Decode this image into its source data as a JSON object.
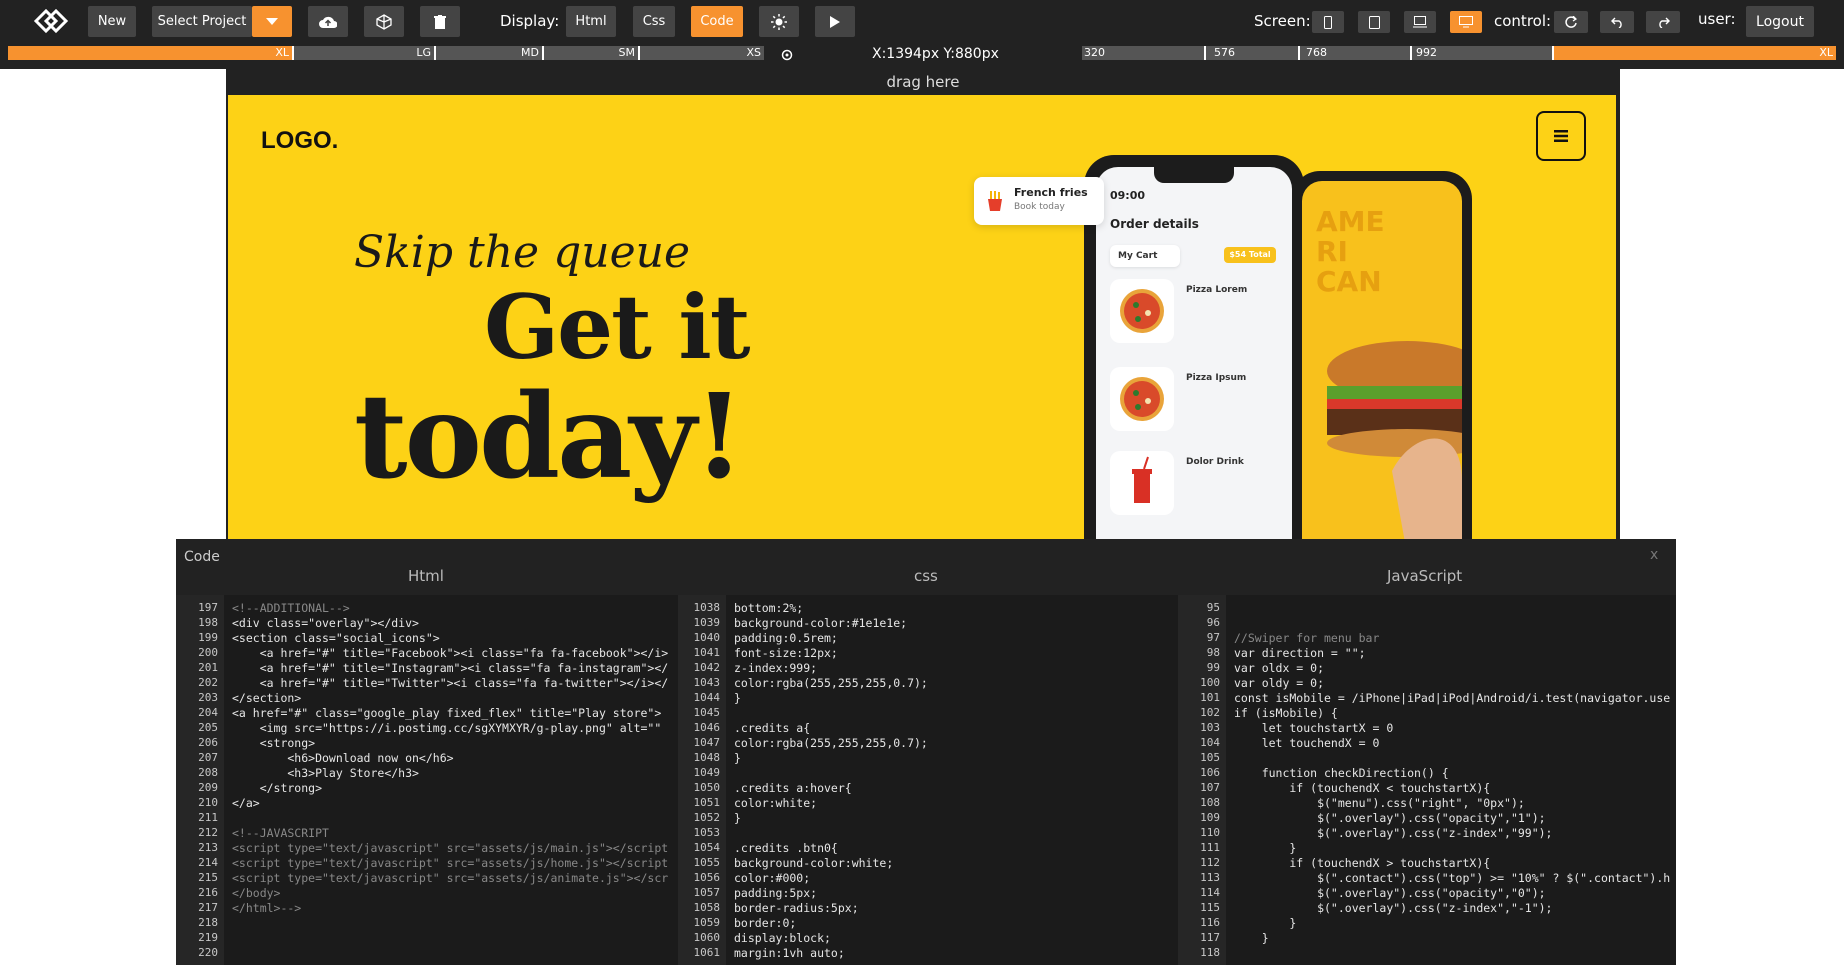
{
  "toolbar": {
    "new_label": "New",
    "project_label": "Select Project",
    "display_label": "Display:",
    "html_label": "Html",
    "css_label": "Css",
    "code_label": "Code",
    "screen_label": "Screen:",
    "control_label": "control:",
    "user_label": "user:",
    "logout_label": "Logout",
    "accent_color": "#f7922f"
  },
  "ruler": {
    "xl_label": "XL",
    "lg_label": "LG",
    "md_label": "MD",
    "sm_label": "SM",
    "xs_label": "XS",
    "coords": "X:1394px Y:880px",
    "bp_320": "320",
    "bp_576": "576",
    "bp_768": "768",
    "bp_992": "992",
    "xl_right": "XL"
  },
  "canvas": {
    "drag_label": "drag here",
    "logo": "LOGO.",
    "tagline": "Skip the queue",
    "headline1": "Get it",
    "headline2": "today!",
    "card_title": "French fries",
    "card_sub": "Book today",
    "phone_time": "09:00",
    "order_title": "Order details",
    "my_cart": "My Cart",
    "total": "$54 Total",
    "item1": "Pizza Lorem",
    "item2": "Pizza Ipsum",
    "item3": "Dolor Drink",
    "brand_color": "#fdd216"
  },
  "code": {
    "title": "Code",
    "close": "x",
    "html_header": "Html",
    "css_header": "css",
    "js_header": "JavaScript",
    "html_lines": [
      {
        "n": "197",
        "t": "<!--ADDITIONAL-->"
      },
      {
        "n": "198",
        "t": "<div class=\"overlay\"></div>"
      },
      {
        "n": "199",
        "t": "<section class=\"social_icons\">"
      },
      {
        "n": "200",
        "t": "    <a href=\"#\" title=\"Facebook\"><i class=\"fa fa-facebook\"></i>"
      },
      {
        "n": "201",
        "t": "    <a href=\"#\" title=\"Instagram\"><i class=\"fa fa-instagram\"></"
      },
      {
        "n": "202",
        "t": "    <a href=\"#\" title=\"Twitter\"><i class=\"fa fa-twitter\"></i></"
      },
      {
        "n": "203",
        "t": "</section>"
      },
      {
        "n": "204",
        "t": "<a href=\"#\" class=\"google_play fixed_flex\" title=\"Play store\">"
      },
      {
        "n": "205",
        "t": "    <img src=\"https://i.postimg.cc/sgXYMXYR/g-play.png\" alt=\"\""
      },
      {
        "n": "206",
        "t": "    <strong>"
      },
      {
        "n": "207",
        "t": "        <h6>Download now on</h6>"
      },
      {
        "n": "208",
        "t": "        <h3>Play Store</h3>"
      },
      {
        "n": "209",
        "t": "    </strong>"
      },
      {
        "n": "210",
        "t": "</a>"
      },
      {
        "n": "211",
        "t": ""
      },
      {
        "n": "212",
        "t": "<!--JAVASCRIPT"
      },
      {
        "n": "213",
        "t": "<script type=\"text/javascript\" src=\"assets/js/main.js\"></script"
      },
      {
        "n": "214",
        "t": "<script type=\"text/javascript\" src=\"assets/js/home.js\"></script"
      },
      {
        "n": "215",
        "t": "<script type=\"text/javascript\" src=\"assets/js/animate.js\"></scr"
      },
      {
        "n": "216",
        "t": "</body>"
      },
      {
        "n": "217",
        "t": "</html>-->"
      },
      {
        "n": "218",
        "t": ""
      },
      {
        "n": "219",
        "t": ""
      },
      {
        "n": "220",
        "t": ""
      }
    ],
    "css_lines": [
      {
        "n": "1038",
        "t": "bottom:2%;"
      },
      {
        "n": "1039",
        "t": "background-color:#1e1e1e;"
      },
      {
        "n": "1040",
        "t": "padding:0.5rem;"
      },
      {
        "n": "1041",
        "t": "font-size:12px;"
      },
      {
        "n": "1042",
        "t": "z-index:999;"
      },
      {
        "n": "1043",
        "t": "color:rgba(255,255,255,0.7);"
      },
      {
        "n": "1044",
        "t": "}"
      },
      {
        "n": "1045",
        "t": ""
      },
      {
        "n": "1046",
        "t": ".credits a{"
      },
      {
        "n": "1047",
        "t": "color:rgba(255,255,255,0.7);"
      },
      {
        "n": "1048",
        "t": "}"
      },
      {
        "n": "1049",
        "t": ""
      },
      {
        "n": "1050",
        "t": ".credits a:hover{"
      },
      {
        "n": "1051",
        "t": "color:white;"
      },
      {
        "n": "1052",
        "t": "}"
      },
      {
        "n": "1053",
        "t": ""
      },
      {
        "n": "1054",
        "t": ".credits .btn0{"
      },
      {
        "n": "1055",
        "t": "background-color:white;"
      },
      {
        "n": "1056",
        "t": "color:#000;"
      },
      {
        "n": "1057",
        "t": "padding:5px;"
      },
      {
        "n": "1058",
        "t": "border-radius:5px;"
      },
      {
        "n": "1059",
        "t": "border:0;"
      },
      {
        "n": "1060",
        "t": "display:block;"
      },
      {
        "n": "1061",
        "t": "margin:1vh auto;"
      }
    ],
    "js_lines": [
      {
        "n": "95",
        "t": ""
      },
      {
        "n": "96",
        "t": ""
      },
      {
        "n": "97",
        "t": "//Swiper for menu bar"
      },
      {
        "n": "98",
        "t": "var direction = \"\";"
      },
      {
        "n": "99",
        "t": "var oldx = 0;"
      },
      {
        "n": "100",
        "t": "var oldy = 0;"
      },
      {
        "n": "101",
        "t": "const isMobile = /iPhone|iPad|iPod|Android/i.test(navigator.use"
      },
      {
        "n": "102",
        "t": "if (isMobile) {"
      },
      {
        "n": "103",
        "t": "    let touchstartX = 0"
      },
      {
        "n": "104",
        "t": "    let touchendX = 0"
      },
      {
        "n": "105",
        "t": ""
      },
      {
        "n": "106",
        "t": "    function checkDirection() {"
      },
      {
        "n": "107",
        "t": "        if (touchendX < touchstartX){"
      },
      {
        "n": "108",
        "t": "            $(\"menu\").css(\"right\", \"0px\");"
      },
      {
        "n": "109",
        "t": "            $(\".overlay\").css(\"opacity\",\"1\");"
      },
      {
        "n": "110",
        "t": "            $(\".overlay\").css(\"z-index\",\"99\");"
      },
      {
        "n": "111",
        "t": "        }"
      },
      {
        "n": "112",
        "t": "        if (touchendX > touchstartX){"
      },
      {
        "n": "113",
        "t": "            $(\".contact\").css(\"top\") >= \"10%\" ? $(\".contact\").h"
      },
      {
        "n": "114",
        "t": "            $(\".overlay\").css(\"opacity\",\"0\");"
      },
      {
        "n": "115",
        "t": "            $(\".overlay\").css(\"z-index\",\"-1\");"
      },
      {
        "n": "116",
        "t": "        }"
      },
      {
        "n": "117",
        "t": "    }"
      },
      {
        "n": "118",
        "t": ""
      }
    ]
  }
}
